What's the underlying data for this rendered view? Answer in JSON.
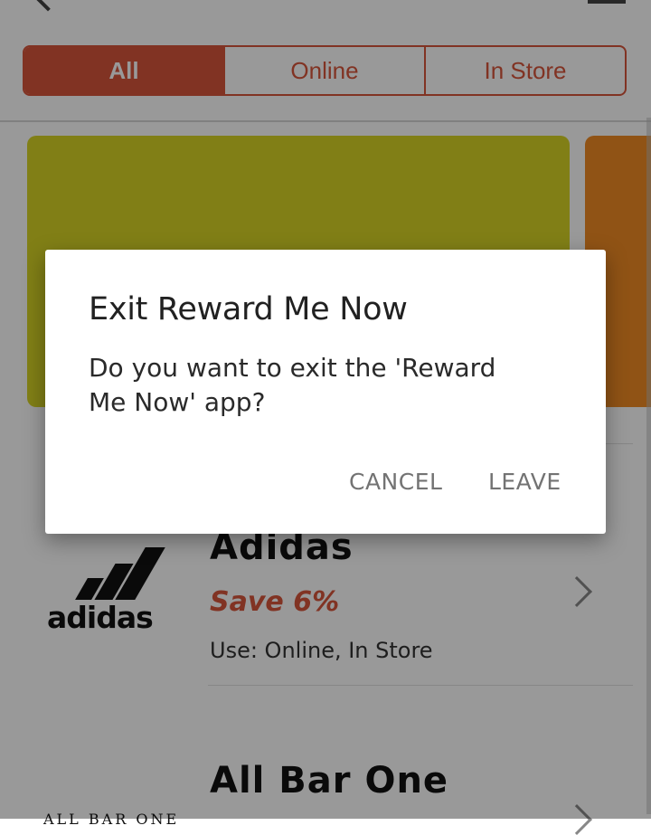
{
  "filter_tabs": [
    {
      "label": "All",
      "active": true
    },
    {
      "label": "Online",
      "active": false
    },
    {
      "label": "In Store",
      "active": false
    }
  ],
  "colors": {
    "accent": "#d8553b",
    "banner_primary": "#d7d426",
    "banner_secondary": "#f08a23"
  },
  "merchants": [
    {
      "logo_text": "adidas",
      "name": "Adidas",
      "save": "Save 6%",
      "use": "Use: Online, In Store",
      "logo_icon": "adidas-logo"
    },
    {
      "logo_text": "ALL BAR ONE",
      "name": "All Bar One",
      "logo_icon": "all-bar-one-logo"
    }
  ],
  "dialog": {
    "title": "Exit Reward Me Now",
    "message": "Do you want to exit the 'Reward Me Now' app?",
    "cancel_label": "CANCEL",
    "leave_label": "LEAVE"
  },
  "icons": {
    "back": "back-arrow-icon",
    "menu": "menu-icon",
    "chevron": "chevron-right-icon"
  }
}
